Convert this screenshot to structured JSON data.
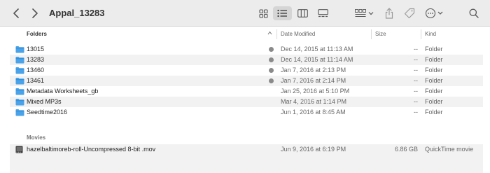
{
  "window": {
    "title": "Appal_13283"
  },
  "toolbar": {
    "icons": [
      "chevron-left-icon",
      "chevron-right-icon",
      "grid-view-icon",
      "list-view-icon",
      "column-view-icon",
      "gallery-view-icon",
      "group-icon",
      "share-icon",
      "tag-icon",
      "more-icon",
      "search-icon"
    ],
    "accent": "#d5d5d5"
  },
  "columns": {
    "name": "Folders",
    "date": "Date Modified",
    "size": "Size",
    "kind": "Kind"
  },
  "folders": [
    {
      "name": "13015",
      "date": "Dec 14, 2015 at 11:13 AM",
      "size": "--",
      "kind": "Folder",
      "dot": true
    },
    {
      "name": "13283",
      "date": "Dec 14, 2015 at 11:14 AM",
      "size": "--",
      "kind": "Folder",
      "dot": true
    },
    {
      "name": "13460",
      "date": "Jan 7, 2016 at 2:13 PM",
      "size": "--",
      "kind": "Folder",
      "dot": true
    },
    {
      "name": "13461",
      "date": "Jan 7, 2016 at 2:14 PM",
      "size": "--",
      "kind": "Folder",
      "dot": true
    },
    {
      "name": "Metadata Worksheets_gb",
      "date": "Jan 25, 2016 at 5:10 PM",
      "size": "--",
      "kind": "Folder",
      "dot": false
    },
    {
      "name": "Mixed MP3s",
      "date": "Mar 4, 2016 at 1:14 PM",
      "size": "--",
      "kind": "Folder",
      "dot": false
    },
    {
      "name": "Seedtime2016",
      "date": "Jun 1, 2016 at 8:45 AM",
      "size": "--",
      "kind": "Folder",
      "dot": false
    }
  ],
  "movies_section": {
    "label": "Movies"
  },
  "movies": [
    {
      "name": "hazelbaltimoreb-roll-Uncompressed 8-bit .mov",
      "date": "Jun 9, 2016 at 6:19 PM",
      "size": "6.86 GB",
      "kind": "QuickTime movie"
    }
  ],
  "colors": {
    "folder": "#4aa3e8",
    "folder_tab": "#2f8ed9",
    "tag_dot": "#8a8a8a",
    "alt_row": "#f2f2f2"
  }
}
